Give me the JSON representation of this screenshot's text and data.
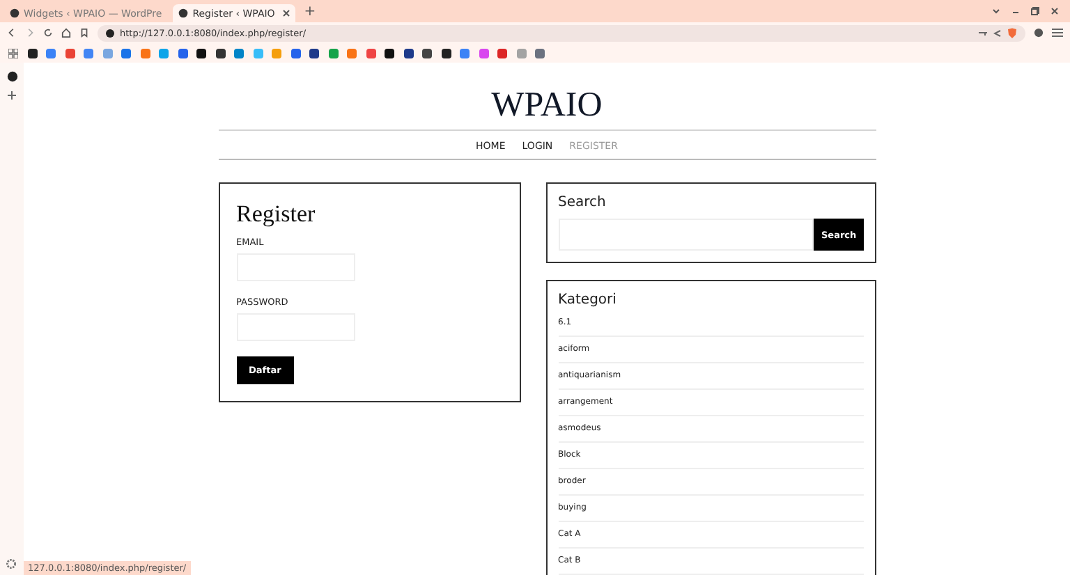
{
  "browser": {
    "tabs": [
      {
        "title": "Widgets ‹ WPAIO — WordPre",
        "selected": false
      },
      {
        "title": "Register ‹ WPAIO",
        "selected": true
      }
    ],
    "new_tab": "+",
    "url": "http://127.0.0.1:8080/index.php/register/",
    "status_url": "127.0.0.1:8080/index.php/register/"
  },
  "site": {
    "title": "WPAIO",
    "nav": [
      {
        "label": "HOME",
        "selected": false
      },
      {
        "label": "LOGIN",
        "selected": false
      },
      {
        "label": "REGISTER",
        "selected": true
      }
    ]
  },
  "register": {
    "heading": "Register",
    "fields": [
      {
        "label": "EMAIL"
      },
      {
        "label": "PASSWORD"
      }
    ],
    "button": "Daftar"
  },
  "search_widget": {
    "heading": "Search",
    "button": "Search"
  },
  "categories": {
    "heading": "Kategori",
    "items": [
      "6.1",
      "aciform",
      "antiquarianism",
      "arrangement",
      "asmodeus",
      "Block",
      "broder",
      "buying",
      "Cat A",
      "Cat B"
    ]
  }
}
